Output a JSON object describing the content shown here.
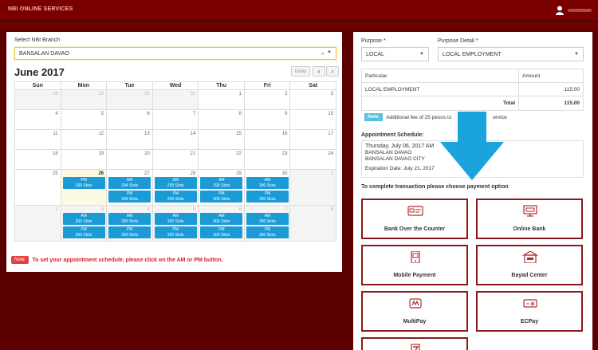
{
  "header": {
    "brand": "NBI ONLINE SERVICES"
  },
  "branch": {
    "label": "Select NBI Branch",
    "value": "BANSALAN DAVAO",
    "clear": "×",
    "caret": "▼"
  },
  "calendar": {
    "title": "June 2017",
    "today_label": "today",
    "prev": "‹",
    "next": "›",
    "weekdays": [
      "Sun",
      "Mon",
      "Tue",
      "Wed",
      "Thu",
      "Fri",
      "Sat"
    ],
    "weeks": [
      [
        {
          "n": "28",
          "o": true
        },
        {
          "n": "29",
          "o": true
        },
        {
          "n": "30",
          "o": true
        },
        {
          "n": "31",
          "o": true
        },
        {
          "n": "1"
        },
        {
          "n": "2"
        },
        {
          "n": "3"
        }
      ],
      [
        {
          "n": "4"
        },
        {
          "n": "5"
        },
        {
          "n": "6"
        },
        {
          "n": "7"
        },
        {
          "n": "8"
        },
        {
          "n": "9"
        },
        {
          "n": "10"
        }
      ],
      [
        {
          "n": "11"
        },
        {
          "n": "12"
        },
        {
          "n": "13"
        },
        {
          "n": "14"
        },
        {
          "n": "15"
        },
        {
          "n": "16"
        },
        {
          "n": "17"
        }
      ],
      [
        {
          "n": "18"
        },
        {
          "n": "19"
        },
        {
          "n": "20"
        },
        {
          "n": "21"
        },
        {
          "n": "22"
        },
        {
          "n": "23"
        },
        {
          "n": "24"
        }
      ],
      [
        {
          "n": "25"
        },
        {
          "n": "26"
        },
        {
          "n": "27"
        },
        {
          "n": "28"
        },
        {
          "n": "29"
        },
        {
          "n": "30"
        },
        {
          "n": "1",
          "o": true
        }
      ],
      [
        {
          "n": "2",
          "o": true
        },
        {
          "n": "3",
          "o": true
        },
        {
          "n": "4",
          "o": true
        },
        {
          "n": "5",
          "o": true
        },
        {
          "n": "6",
          "o": true
        },
        {
          "n": "7",
          "o": true
        },
        {
          "n": "8",
          "o": true
        }
      ]
    ],
    "slots": [
      {
        "w": 4,
        "d": 1,
        "k": 0,
        "s": "PM",
        "c": "299 Slots"
      },
      {
        "w": 4,
        "d": 2,
        "k": 0,
        "s": "AM",
        "c": "294 Slots"
      },
      {
        "w": 4,
        "d": 2,
        "k": 1,
        "s": "PM",
        "c": "296 Slots"
      },
      {
        "w": 4,
        "d": 3,
        "k": 0,
        "s": "AM",
        "c": "299 Slots"
      },
      {
        "w": 4,
        "d": 3,
        "k": 1,
        "s": "PM",
        "c": "299 Slots"
      },
      {
        "w": 4,
        "d": 4,
        "k": 0,
        "s": "AM",
        "c": "299 Slots"
      },
      {
        "w": 4,
        "d": 4,
        "k": 1,
        "s": "PM",
        "c": "300 Slots"
      },
      {
        "w": 4,
        "d": 5,
        "k": 0,
        "s": "AM",
        "c": "300 Slots"
      },
      {
        "w": 4,
        "d": 5,
        "k": 1,
        "s": "PM",
        "c": "300 Slots"
      },
      {
        "w": 5,
        "d": 1,
        "k": 0,
        "s": "AM",
        "c": "300 Slots"
      },
      {
        "w": 5,
        "d": 1,
        "k": 1,
        "s": "PM",
        "c": "300 Slots"
      },
      {
        "w": 5,
        "d": 2,
        "k": 0,
        "s": "AM",
        "c": "300 Slots"
      },
      {
        "w": 5,
        "d": 2,
        "k": 1,
        "s": "PM",
        "c": "300 Slots"
      },
      {
        "w": 5,
        "d": 3,
        "k": 0,
        "s": "AM",
        "c": "300 Slots"
      },
      {
        "w": 5,
        "d": 3,
        "k": 1,
        "s": "PM",
        "c": "300 Slots"
      },
      {
        "w": 5,
        "d": 4,
        "k": 0,
        "s": "AM",
        "c": "300 Slots"
      },
      {
        "w": 5,
        "d": 4,
        "k": 1,
        "s": "PM",
        "c": "300 Slots"
      },
      {
        "w": 5,
        "d": 5,
        "k": 0,
        "s": "AM",
        "c": "300 Slots"
      },
      {
        "w": 5,
        "d": 5,
        "k": 1,
        "s": "PM",
        "c": "300 Slots"
      }
    ]
  },
  "note": {
    "badge": "Note:",
    "text": "To set your appointment schedule, please click on the AM or PM button."
  },
  "purpose": {
    "label": "Purpose *",
    "value": "LOCAL",
    "caret": "▼"
  },
  "purpose_detail": {
    "label": "Purpose Detail *",
    "value": "LOCAL EMPLOYMENT",
    "caret": "▼"
  },
  "fees": {
    "col_particular": "Particular",
    "col_amount": "Amount",
    "item": "LOCAL EMPLOYMENT",
    "item_amount": "115.00",
    "total_label": "Total",
    "total_amount": "115.00"
  },
  "fee_note": {
    "badge": "Note:",
    "text": "Additional fee of 25 pesos to",
    "text_end": "ervice"
  },
  "appointment": {
    "label": "Appointment Schedule:",
    "date": "Thursday, July 06, 2017 AM",
    "branch": "BANSALAN DAVAO",
    "city": "BANSALAN DAVAO CITY",
    "expiration": "Expiration Date: July 21, 2017"
  },
  "payment": {
    "title": "To complete transaction please choose payment option",
    "options": [
      "Bank Over the Counter",
      "Online Bank",
      "Mobile Payment",
      "Bayad Center",
      "MultiPay",
      "ECPay"
    ]
  },
  "colors": {
    "maroon": "#7a0000",
    "card_border": "#8a1a1a",
    "slot_blue": "#1b9ad6",
    "arrow_blue": "#1ba3dc",
    "note_red": "#d42020"
  }
}
